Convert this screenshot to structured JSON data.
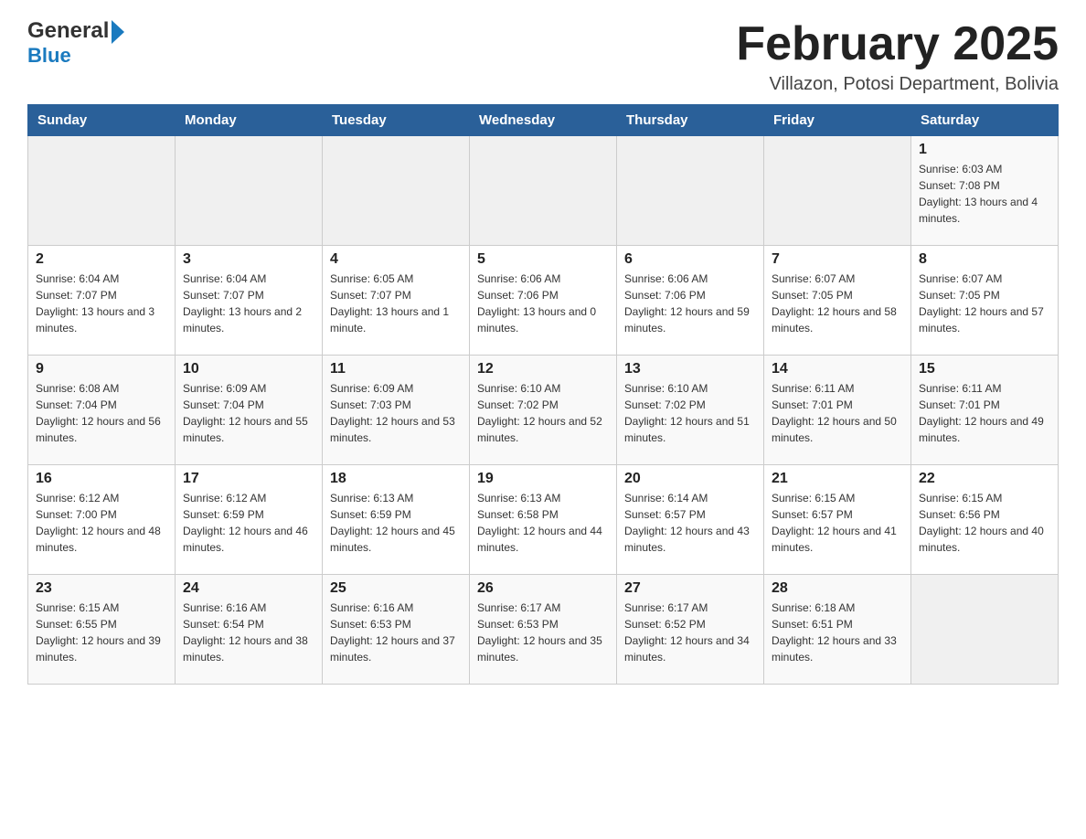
{
  "logo": {
    "text_general": "General",
    "triangle": "▶",
    "text_blue": "Blue"
  },
  "title": "February 2025",
  "subtitle": "Villazon, Potosi Department, Bolivia",
  "days_of_week": [
    "Sunday",
    "Monday",
    "Tuesday",
    "Wednesday",
    "Thursday",
    "Friday",
    "Saturday"
  ],
  "weeks": [
    [
      {
        "day": "",
        "info": ""
      },
      {
        "day": "",
        "info": ""
      },
      {
        "day": "",
        "info": ""
      },
      {
        "day": "",
        "info": ""
      },
      {
        "day": "",
        "info": ""
      },
      {
        "day": "",
        "info": ""
      },
      {
        "day": "1",
        "info": "Sunrise: 6:03 AM\nSunset: 7:08 PM\nDaylight: 13 hours and 4 minutes."
      }
    ],
    [
      {
        "day": "2",
        "info": "Sunrise: 6:04 AM\nSunset: 7:07 PM\nDaylight: 13 hours and 3 minutes."
      },
      {
        "day": "3",
        "info": "Sunrise: 6:04 AM\nSunset: 7:07 PM\nDaylight: 13 hours and 2 minutes."
      },
      {
        "day": "4",
        "info": "Sunrise: 6:05 AM\nSunset: 7:07 PM\nDaylight: 13 hours and 1 minute."
      },
      {
        "day": "5",
        "info": "Sunrise: 6:06 AM\nSunset: 7:06 PM\nDaylight: 13 hours and 0 minutes."
      },
      {
        "day": "6",
        "info": "Sunrise: 6:06 AM\nSunset: 7:06 PM\nDaylight: 12 hours and 59 minutes."
      },
      {
        "day": "7",
        "info": "Sunrise: 6:07 AM\nSunset: 7:05 PM\nDaylight: 12 hours and 58 minutes."
      },
      {
        "day": "8",
        "info": "Sunrise: 6:07 AM\nSunset: 7:05 PM\nDaylight: 12 hours and 57 minutes."
      }
    ],
    [
      {
        "day": "9",
        "info": "Sunrise: 6:08 AM\nSunset: 7:04 PM\nDaylight: 12 hours and 56 minutes."
      },
      {
        "day": "10",
        "info": "Sunrise: 6:09 AM\nSunset: 7:04 PM\nDaylight: 12 hours and 55 minutes."
      },
      {
        "day": "11",
        "info": "Sunrise: 6:09 AM\nSunset: 7:03 PM\nDaylight: 12 hours and 53 minutes."
      },
      {
        "day": "12",
        "info": "Sunrise: 6:10 AM\nSunset: 7:02 PM\nDaylight: 12 hours and 52 minutes."
      },
      {
        "day": "13",
        "info": "Sunrise: 6:10 AM\nSunset: 7:02 PM\nDaylight: 12 hours and 51 minutes."
      },
      {
        "day": "14",
        "info": "Sunrise: 6:11 AM\nSunset: 7:01 PM\nDaylight: 12 hours and 50 minutes."
      },
      {
        "day": "15",
        "info": "Sunrise: 6:11 AM\nSunset: 7:01 PM\nDaylight: 12 hours and 49 minutes."
      }
    ],
    [
      {
        "day": "16",
        "info": "Sunrise: 6:12 AM\nSunset: 7:00 PM\nDaylight: 12 hours and 48 minutes."
      },
      {
        "day": "17",
        "info": "Sunrise: 6:12 AM\nSunset: 6:59 PM\nDaylight: 12 hours and 46 minutes."
      },
      {
        "day": "18",
        "info": "Sunrise: 6:13 AM\nSunset: 6:59 PM\nDaylight: 12 hours and 45 minutes."
      },
      {
        "day": "19",
        "info": "Sunrise: 6:13 AM\nSunset: 6:58 PM\nDaylight: 12 hours and 44 minutes."
      },
      {
        "day": "20",
        "info": "Sunrise: 6:14 AM\nSunset: 6:57 PM\nDaylight: 12 hours and 43 minutes."
      },
      {
        "day": "21",
        "info": "Sunrise: 6:15 AM\nSunset: 6:57 PM\nDaylight: 12 hours and 41 minutes."
      },
      {
        "day": "22",
        "info": "Sunrise: 6:15 AM\nSunset: 6:56 PM\nDaylight: 12 hours and 40 minutes."
      }
    ],
    [
      {
        "day": "23",
        "info": "Sunrise: 6:15 AM\nSunset: 6:55 PM\nDaylight: 12 hours and 39 minutes."
      },
      {
        "day": "24",
        "info": "Sunrise: 6:16 AM\nSunset: 6:54 PM\nDaylight: 12 hours and 38 minutes."
      },
      {
        "day": "25",
        "info": "Sunrise: 6:16 AM\nSunset: 6:53 PM\nDaylight: 12 hours and 37 minutes."
      },
      {
        "day": "26",
        "info": "Sunrise: 6:17 AM\nSunset: 6:53 PM\nDaylight: 12 hours and 35 minutes."
      },
      {
        "day": "27",
        "info": "Sunrise: 6:17 AM\nSunset: 6:52 PM\nDaylight: 12 hours and 34 minutes."
      },
      {
        "day": "28",
        "info": "Sunrise: 6:18 AM\nSunset: 6:51 PM\nDaylight: 12 hours and 33 minutes."
      },
      {
        "day": "",
        "info": ""
      }
    ]
  ]
}
